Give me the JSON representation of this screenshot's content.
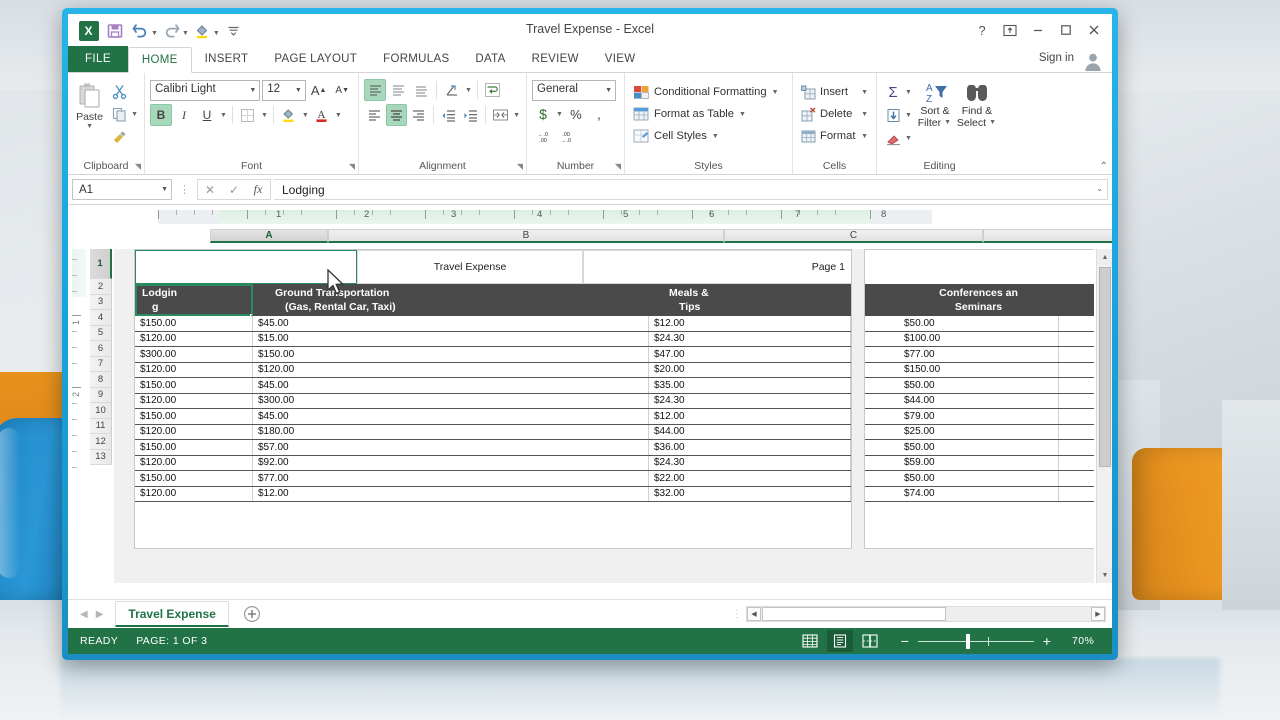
{
  "window": {
    "title": "Travel Expense - Excel",
    "logo": "excel-logo",
    "quick_access": [
      {
        "name": "save-icon",
        "glyph": "💾"
      },
      {
        "name": "undo-icon",
        "glyph": "↶"
      },
      {
        "name": "redo-icon",
        "glyph": "↷"
      },
      {
        "name": "fill-color-icon",
        "glyph": "✒"
      },
      {
        "name": "customize-qat-icon",
        "glyph": "≡"
      }
    ],
    "controls": {
      "help": "?",
      "ribbon_display": "⬆",
      "minimize": "–",
      "maximize": "☐",
      "close": "✕"
    },
    "sign_in": "Sign in"
  },
  "ribbon": {
    "tabs": [
      {
        "label": "FILE",
        "active": false,
        "file": true
      },
      {
        "label": "HOME",
        "active": true
      },
      {
        "label": "INSERT",
        "active": false
      },
      {
        "label": "PAGE LAYOUT",
        "active": false
      },
      {
        "label": "FORMULAS",
        "active": false
      },
      {
        "label": "DATA",
        "active": false
      },
      {
        "label": "REVIEW",
        "active": false
      },
      {
        "label": "VIEW",
        "active": false
      }
    ],
    "groups": {
      "clipboard": {
        "label": "Clipboard",
        "paste": "Paste",
        "cut": "Cut",
        "copy": "Copy",
        "format_painter": "Format Painter"
      },
      "font": {
        "label": "Font",
        "font_name": "Calibri Light",
        "font_size": "12",
        "grow": "A",
        "shrink": "A",
        "bold": "B",
        "italic": "I",
        "underline": "U",
        "borders": "Borders",
        "fill_color": "Fill Color",
        "font_color": "A"
      },
      "alignment": {
        "label": "Alignment",
        "top_align": "Top Align",
        "middle_align": "Middle Align",
        "bottom_align": "Bottom Align",
        "orientation": "Orientation",
        "align_left": "Align Left",
        "center": "Center",
        "align_right": "Align Right",
        "decrease_indent": "Decrease Indent",
        "increase_indent": "Increase Indent",
        "wrap_text": "Wrap Text",
        "merge_center": "Merge & Center"
      },
      "number": {
        "label": "Number",
        "format": "General",
        "accounting": "$",
        "percent": "%",
        "comma": ",",
        "increase_decimal": ".00",
        "decrease_decimal": ".00"
      },
      "styles": {
        "label": "Styles",
        "conditional_formatting": "Conditional Formatting",
        "format_as_table": "Format as Table",
        "cell_styles": "Cell Styles"
      },
      "cells": {
        "label": "Cells",
        "insert": "Insert",
        "delete": "Delete",
        "format": "Format"
      },
      "editing": {
        "label": "Editing",
        "autosum": "Σ",
        "fill": "Fill",
        "clear": "Clear",
        "sort_filter_l1": "Sort &",
        "sort_filter_l2": "Filter",
        "find_select_l1": "Find &",
        "find_select_l2": "Select"
      }
    },
    "collapse": "⌃"
  },
  "formula_bar": {
    "name_box": "A1",
    "cancel": "✕",
    "enter": "✓",
    "fx": "fx",
    "value": "Lodging",
    "expand": "⌄"
  },
  "sheet": {
    "ruler_numbers": [
      "1",
      "2",
      "3",
      "4",
      "5",
      "6",
      "7",
      "8"
    ],
    "vruler_numbers": [
      "1",
      "2"
    ],
    "column_headers": [
      "A",
      "B",
      "C",
      ""
    ],
    "selected_column": "A",
    "row_headers": [
      "1",
      "2",
      "3",
      "4",
      "5",
      "6",
      "7",
      "8",
      "9",
      "10",
      "11",
      "12",
      "13"
    ],
    "selected_row": "1",
    "page_header": {
      "left": "",
      "center": "Travel Expense",
      "right": "Page 1"
    },
    "table_headers": [
      {
        "line1": "Lodgin",
        "line2": "g",
        "align": "left",
        "selected": true
      },
      {
        "line1": "Ground Transportation",
        "line2": "(Gas, Rental Car, Taxi)",
        "align": "center",
        "selected": false
      },
      {
        "line1": "Meals &",
        "line2": "Tips",
        "align": "left",
        "selected": false
      }
    ],
    "page2_header": {
      "line1": "Conferences an",
      "line2": "Seminars"
    },
    "rows": [
      {
        "lodging": "$150.00",
        "ground": "$45.00",
        "meals": "$12.00",
        "conf": "$50.00"
      },
      {
        "lodging": "$120.00",
        "ground": "$15.00",
        "meals": "$24.30",
        "conf": "$100.00"
      },
      {
        "lodging": "$300.00",
        "ground": "$150.00",
        "meals": "$47.00",
        "conf": "$77.00"
      },
      {
        "lodging": "$120.00",
        "ground": "$120.00",
        "meals": "$20.00",
        "conf": "$150.00"
      },
      {
        "lodging": "$150.00",
        "ground": "$45.00",
        "meals": "$35.00",
        "conf": "$50.00"
      },
      {
        "lodging": "$120.00",
        "ground": "$300.00",
        "meals": "$24.30",
        "conf": "$44.00"
      },
      {
        "lodging": "$150.00",
        "ground": "$45.00",
        "meals": "$12.00",
        "conf": "$79.00"
      },
      {
        "lodging": "$120.00",
        "ground": "$180.00",
        "meals": "$44.00",
        "conf": "$25.00"
      },
      {
        "lodging": "$150.00",
        "ground": "$57.00",
        "meals": "$36.00",
        "conf": "$50.00"
      },
      {
        "lodging": "$120.00",
        "ground": "$92.00",
        "meals": "$24.30",
        "conf": "$59.00"
      },
      {
        "lodging": "$150.00",
        "ground": "$77.00",
        "meals": "$22.00",
        "conf": "$50.00"
      },
      {
        "lodging": "$120.00",
        "ground": "$12.00",
        "meals": "$32.00",
        "conf": "$74.00"
      }
    ]
  },
  "sheet_tabs": {
    "prev": "◀",
    "next": "▶",
    "tabs": [
      {
        "label": "Travel Expense",
        "active": true
      }
    ],
    "add": "+",
    "scroll_left": "◀",
    "scroll_right": "▶"
  },
  "status_bar": {
    "state": "READY",
    "page_info": "PAGE: 1 OF 3",
    "views": [
      {
        "name": "normal-view-icon",
        "active": false
      },
      {
        "name": "page-layout-view-icon",
        "active": true
      },
      {
        "name": "page-break-preview-icon",
        "active": false
      }
    ],
    "zoom_out": "−",
    "zoom_in": "+",
    "zoom_level": "70%"
  },
  "colors": {
    "excel_green": "#217346",
    "header_dark": "#4a4a4a",
    "selection_green": "#2a8a5d",
    "frame_cyan": "#17a2dc"
  }
}
